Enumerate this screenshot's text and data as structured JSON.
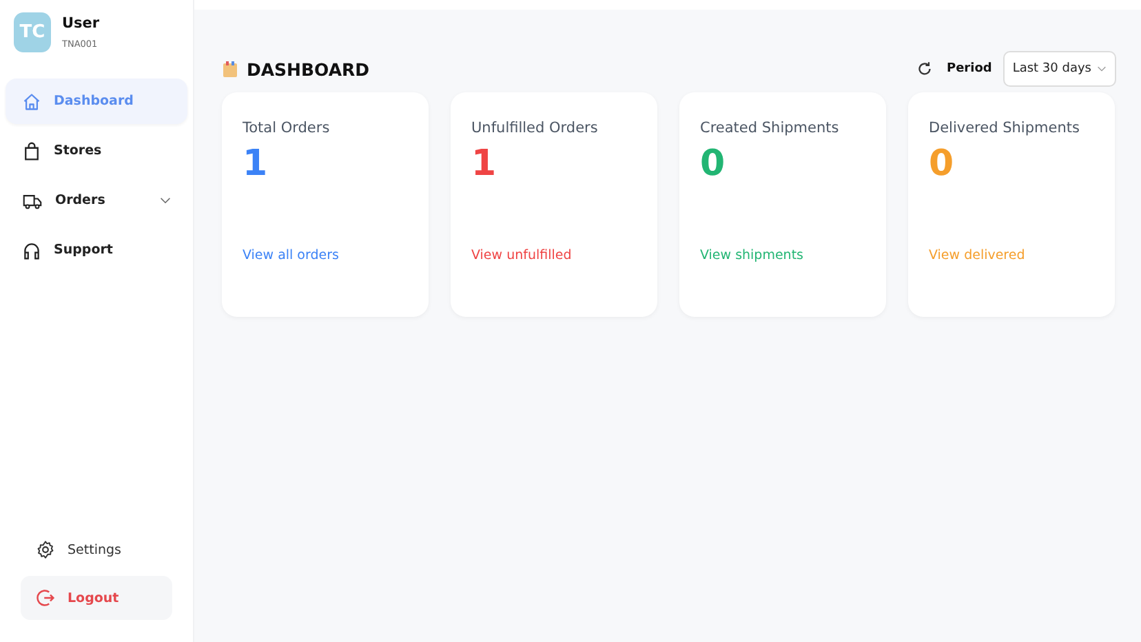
{
  "user": {
    "initials": "TC",
    "name": "User",
    "code": "TNA001"
  },
  "nav": [
    {
      "label": "Dashboard",
      "selected": true
    },
    {
      "label": "Stores",
      "selected": false
    },
    {
      "label": "Orders",
      "selected": false,
      "expanded": false
    },
    {
      "label": "Support",
      "selected": false
    }
  ],
  "settings": {
    "label": "Settings"
  },
  "logout": {
    "label": "Logout"
  },
  "header": {
    "title": "DASHBOARD",
    "period_label": "Period",
    "period_value": "Last 30 days"
  },
  "cards": [
    {
      "title": "Total Orders",
      "value": "1",
      "link": "View all orders",
      "color": "#3b82f6"
    },
    {
      "title": "Unfulfilled Orders",
      "value": "1",
      "link": "View unfulfilled",
      "color": "#ef4444"
    },
    {
      "title": "Created Shipments",
      "value": "0",
      "link": "View shipments",
      "color": "#22b573"
    },
    {
      "title": "Delivered Shipments",
      "value": "0",
      "link": "View delivered",
      "color": "#f59e2b"
    }
  ]
}
